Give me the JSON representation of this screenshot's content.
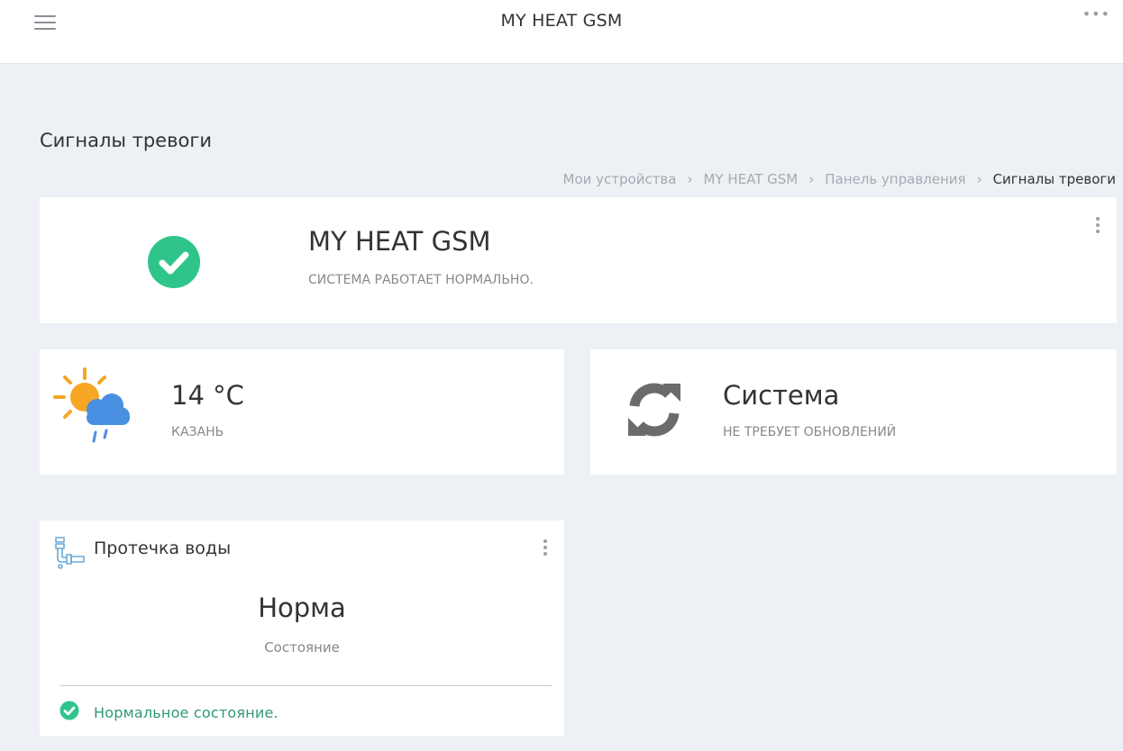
{
  "header": {
    "app_title": "MY HEAT GSM",
    "menu_icon": "hamburger-menu-icon",
    "more_icon": "more-horizontal-icon",
    "more_glyph": "•••"
  },
  "page": {
    "title": "Сигналы тревоги"
  },
  "breadcrumb": {
    "items": [
      "Мои устройства",
      "MY HEAT GSM",
      "Панель управления"
    ],
    "current": "Сигналы тревоги",
    "separator": "›"
  },
  "status_card": {
    "icon": "check-circle-icon",
    "device_name": "MY HEAT GSM",
    "status_text": "СИСТЕМА РАБОТАЕТ НОРМАЛЬНО.",
    "accent_color": "#2fc58a"
  },
  "weather_card": {
    "icon": "sun-cloud-rain-icon",
    "temperature": "14 °C",
    "city": "КАЗАНЬ"
  },
  "update_card": {
    "icon": "refresh-icon",
    "title": "Система",
    "subtitle": "НЕ ТРЕБУЕТ ОБНОВЛЕНИЙ"
  },
  "leak_card": {
    "icon": "water-pipe-icon",
    "title": "Протечка воды",
    "value": "Норма",
    "caption": "Состояние",
    "footer_icon": "check-circle-icon",
    "footer_text": "Нормальное состояние.",
    "footer_color": "#2e9a6f"
  }
}
